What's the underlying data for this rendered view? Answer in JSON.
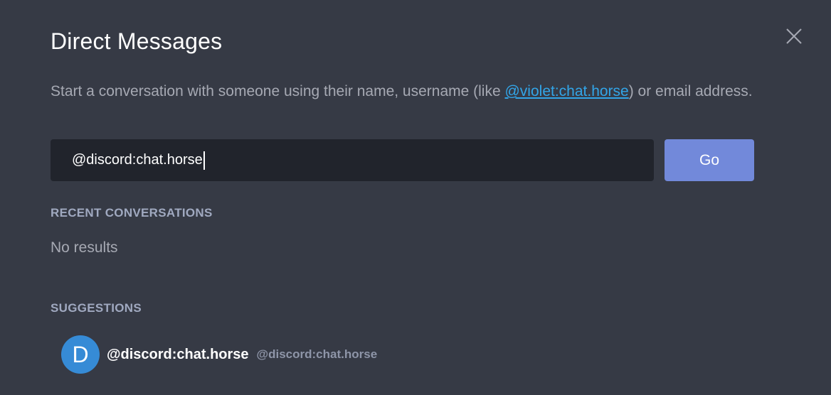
{
  "dialog": {
    "title": "Direct Messages",
    "description_before": "Start a conversation with someone using their name, username (like ",
    "description_link": "@violet:chat.horse",
    "description_after": ") or email address."
  },
  "search": {
    "value": "@discord:chat.horse"
  },
  "buttons": {
    "go_label": "Go"
  },
  "recent": {
    "heading": "RECENT CONVERSATIONS",
    "empty_text": "No results"
  },
  "suggestions": {
    "heading": "SUGGESTIONS",
    "items": [
      {
        "avatar_letter": "D",
        "display_name": "@discord:chat.horse",
        "user_id": "@discord:chat.horse"
      }
    ]
  },
  "colors": {
    "background": "#363a45",
    "accent": "#7289da",
    "link": "#32a5e8",
    "avatar": "#368bd6"
  },
  "icons": {
    "close": "close-icon"
  }
}
